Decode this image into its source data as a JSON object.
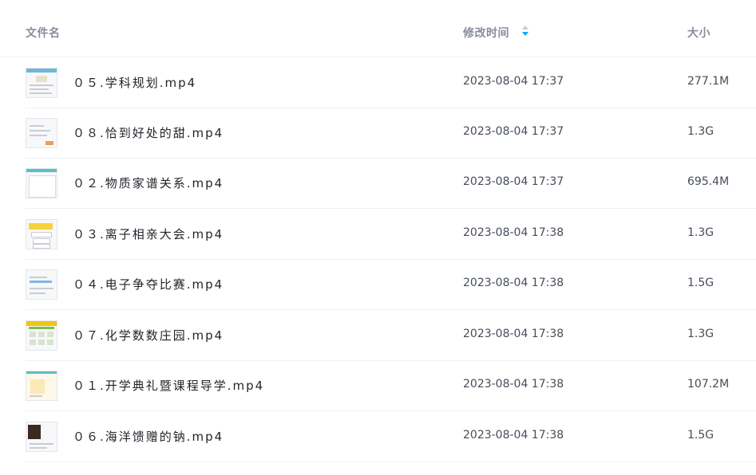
{
  "header": {
    "name_label": "文件名",
    "time_label": "修改时间",
    "size_label": "大小",
    "sort_icon": "sort-descending-icon",
    "accent_color": "#06a7ff"
  },
  "files": [
    {
      "name": "０５.学科规划.mp4",
      "modified": "2023-08-04 17:37",
      "size": "277.1M",
      "thumb_icon": "video-thumbnail-icon"
    },
    {
      "name": "０８.恰到好处的甜.mp4",
      "modified": "2023-08-04 17:37",
      "size": "1.3G",
      "thumb_icon": "video-thumbnail-icon"
    },
    {
      "name": "０２.物质家谱关系.mp4",
      "modified": "2023-08-04 17:37",
      "size": "695.4M",
      "thumb_icon": "video-thumbnail-icon"
    },
    {
      "name": "０３.离子相亲大会.mp4",
      "modified": "2023-08-04 17:38",
      "size": "1.3G",
      "thumb_icon": "video-thumbnail-icon"
    },
    {
      "name": "０４.电子争夺比赛.mp4",
      "modified": "2023-08-04 17:38",
      "size": "1.5G",
      "thumb_icon": "video-thumbnail-icon"
    },
    {
      "name": "０７.化学数数庄园.mp4",
      "modified": "2023-08-04 17:38",
      "size": "1.3G",
      "thumb_icon": "video-thumbnail-icon"
    },
    {
      "name": "０１.开学典礼暨课程导学.mp4",
      "modified": "2023-08-04 17:38",
      "size": "107.2M",
      "thumb_icon": "video-thumbnail-icon"
    },
    {
      "name": "０６.海洋馈赠的钠.mp4",
      "modified": "2023-08-04 17:38",
      "size": "1.5G",
      "thumb_icon": "video-thumbnail-icon"
    }
  ]
}
